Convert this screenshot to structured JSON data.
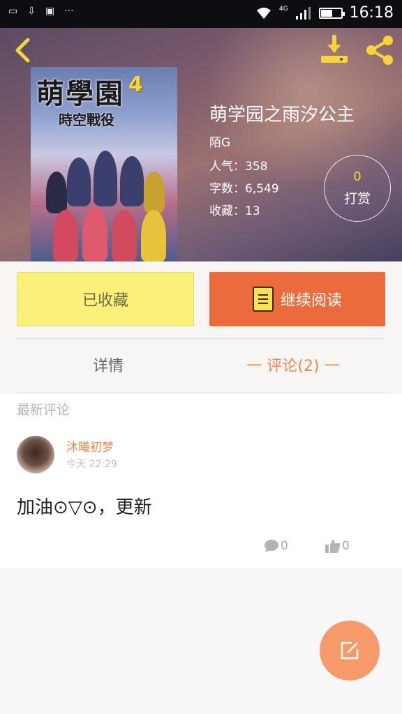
{
  "status_bar": {
    "left_icons": [
      "notification-icon",
      "download-status-icon",
      "message-icon"
    ],
    "dots": "···",
    "network": "4G",
    "battery_level": 0.55,
    "time": "16:18"
  },
  "header": {
    "cover": {
      "title": "萌學園",
      "number": "4",
      "subtitle": "時空戰役"
    },
    "book_title": "萌学园之雨汐公主",
    "author": "陌G",
    "popularity": "人气：358",
    "word_count": "字数：6,549",
    "favorites": "收藏：13",
    "reward": {
      "count": "0",
      "label": "打赏"
    }
  },
  "actions": {
    "collected_label": "已收藏",
    "continue_label": "继续阅读"
  },
  "tabs": {
    "detail_label": "详情",
    "comments_label": "一 评论(2) 一"
  },
  "comments": {
    "section_label": "最新评论",
    "items": [
      {
        "username": "沐曦初梦",
        "time": "今天 22:29",
        "text": "加油⊙▽⊙，更新",
        "replies": "0",
        "likes": "0"
      }
    ]
  },
  "colors": {
    "accent_orange": "#ec6b3c",
    "collected_yellow": "#fbf07a",
    "fab": "#f79a6a"
  }
}
